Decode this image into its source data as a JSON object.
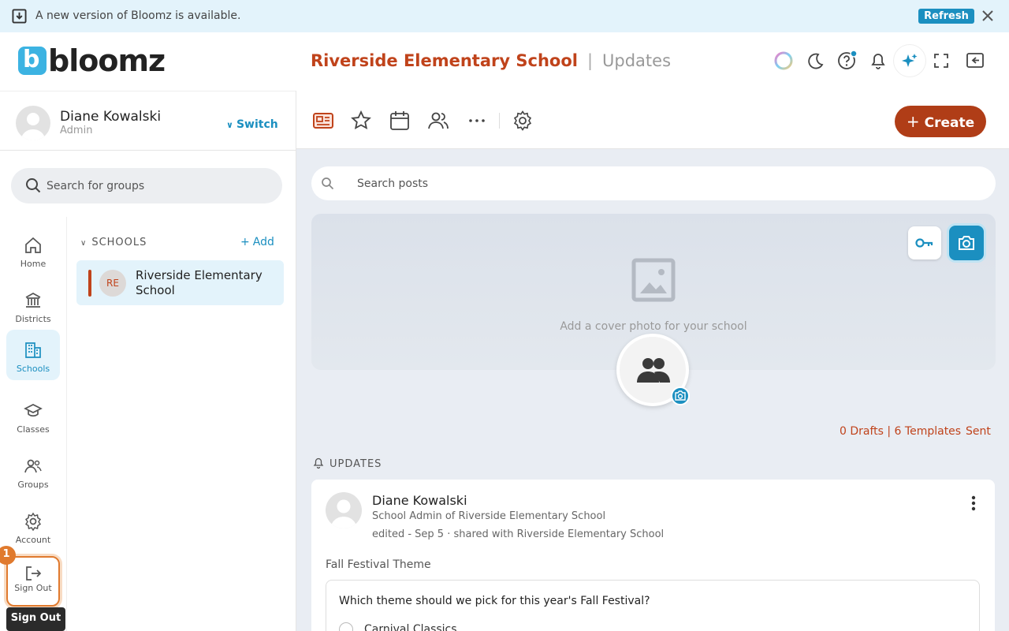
{
  "banner": {
    "message": "A new version of Bloomz is available.",
    "refresh_label": "Refresh"
  },
  "header": {
    "logo_text": "bloomz",
    "logo_letter": "b",
    "school_name": "Riverside Elementary School",
    "separator": "|",
    "page_name": "Updates"
  },
  "profile": {
    "name": "Diane Kowalski",
    "role": "Admin",
    "switch_label": "Switch"
  },
  "group_search": {
    "placeholder": "Search for groups"
  },
  "nav": {
    "home": "Home",
    "districts": "Districts",
    "schools": "Schools",
    "classes": "Classes",
    "groups": "Groups",
    "account": "Account",
    "signout": "Sign Out"
  },
  "step_badge": "1",
  "tooltip": "Sign Out",
  "schools": {
    "header": "SCHOOLS",
    "add_label": "Add",
    "items": [
      {
        "initials": "RE",
        "name": "Riverside Elementary School"
      }
    ]
  },
  "toolbar": {
    "create_label": "Create"
  },
  "post_search": {
    "placeholder": "Search posts"
  },
  "cover": {
    "prompt": "Add a cover photo for your school"
  },
  "drafts": {
    "summary": "0 Drafts | 6 Templates",
    "sent_label": "Sent"
  },
  "updates_header": "UPDATES",
  "post": {
    "author": "Diane Kowalski",
    "subtitle": "School Admin of Riverside Elementary School",
    "meta": "edited - Sep 5 · shared with Riverside Elementary School",
    "title": "Fall Festival Theme",
    "question": "Which theme should we pick for this year's Fall Festival?",
    "options": [
      "Carnival Classics"
    ]
  },
  "colors": {
    "accent": "#1b8fc0",
    "brand": "#c0431b",
    "create_bg": "#b03d17",
    "highlight": "#e07a2e"
  }
}
